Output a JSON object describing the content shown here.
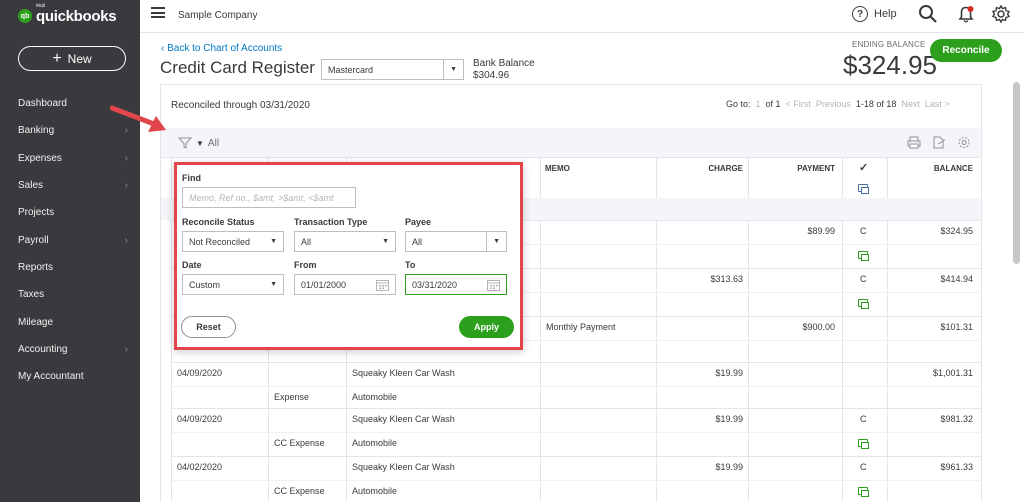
{
  "brand": {
    "intuit": "intuit",
    "name": "quickbooks"
  },
  "sidebar": {
    "new_label": "New",
    "items": [
      {
        "label": "Dashboard",
        "chevron": false
      },
      {
        "label": "Banking",
        "chevron": true
      },
      {
        "label": "Expenses",
        "chevron": true
      },
      {
        "label": "Sales",
        "chevron": true
      },
      {
        "label": "Projects",
        "chevron": false
      },
      {
        "label": "Payroll",
        "chevron": true
      },
      {
        "label": "Reports",
        "chevron": false
      },
      {
        "label": "Taxes",
        "chevron": false
      },
      {
        "label": "Mileage",
        "chevron": false
      },
      {
        "label": "Accounting",
        "chevron": true
      },
      {
        "label": "My Accountant",
        "chevron": false
      }
    ]
  },
  "header": {
    "company": "Sample Company",
    "help": "Help"
  },
  "page": {
    "back_link": "Back to Chart of Accounts",
    "title": "Credit Card Register",
    "account": "Mastercard",
    "bank_balance_label": "Bank Balance",
    "bank_balance_value": "$304.96",
    "ending_balance_label": "ENDING BALANCE",
    "ending_balance_value": "$324.95",
    "reconcile_label": "Reconcile",
    "reconciled_through": "Reconciled through 03/31/2020"
  },
  "pager": {
    "goto": "Go to:",
    "page": "1",
    "of": "of 1",
    "first": "< First",
    "previous": "Previous",
    "range": "1-18 of 18",
    "next": "Next",
    "last": "Last >"
  },
  "filter": {
    "toggle_label": "All",
    "find_label": "Find",
    "find_placeholder": "Memo, Ref no., $amt, >$amt, <$amt",
    "reconcile_status_label": "Reconcile Status",
    "reconcile_status_value": "Not Reconciled",
    "transaction_type_label": "Transaction Type",
    "transaction_type_value": "All",
    "payee_label": "Payee",
    "payee_value": "All",
    "date_label": "Date",
    "date_value": "Custom",
    "from_label": "From",
    "from_value": "01/01/2000",
    "to_label": "To",
    "to_value": "03/31/2020",
    "reset_label": "Reset",
    "apply_label": "Apply"
  },
  "table": {
    "headers": {
      "memo": "MEMO",
      "charge": "CHARGE",
      "payment": "PAYMENT",
      "check": "✓",
      "balance": "BALANCE"
    },
    "rows": [
      {
        "date": "",
        "type": "",
        "payee": "",
        "account": "",
        "memo": "",
        "charge": "",
        "payment": "$89.99",
        "status": "C",
        "balance": "$324.95"
      },
      {
        "date": "",
        "type": "",
        "payee": "",
        "account": "",
        "memo": "",
        "charge": "$313.63",
        "payment": "",
        "status": "C",
        "balance": "$414.94"
      },
      {
        "date": "",
        "type": "",
        "payee": "",
        "account": "",
        "memo": "Monthly Payment",
        "charge": "",
        "payment": "$900.00",
        "status": "",
        "balance": "$101.31"
      },
      {
        "date": "04/09/2020",
        "type": "Expense",
        "payee": "Squeaky Kleen Car Wash",
        "account": "Automobile",
        "memo": "",
        "charge": "$19.99",
        "payment": "",
        "status": "",
        "balance": "$1,001.31"
      },
      {
        "date": "04/09/2020",
        "type": "CC Expense",
        "payee": "Squeaky Kleen Car Wash",
        "account": "Automobile",
        "memo": "",
        "charge": "$19.99",
        "payment": "",
        "status": "C",
        "balance": "$981.32"
      },
      {
        "date": "04/02/2020",
        "type": "CC Expense",
        "payee": "Squeaky Kleen Car Wash",
        "account": "Automobile",
        "memo": "",
        "charge": "$19.99",
        "payment": "",
        "status": "C",
        "balance": "$961.33"
      }
    ]
  }
}
